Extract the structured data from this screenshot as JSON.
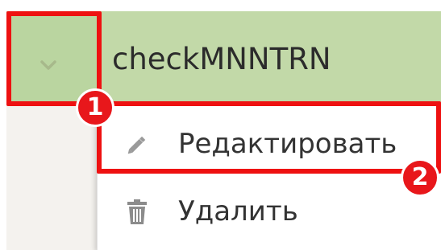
{
  "row": {
    "title": "checkMNNTRN",
    "toggle_icon": "chevron-down-icon"
  },
  "menu": {
    "items": [
      {
        "label": "Редактировать",
        "icon": "pencil-icon"
      },
      {
        "label": "Удалить",
        "icon": "trash-icon"
      }
    ]
  },
  "annotations": {
    "markers": [
      {
        "label": "1",
        "color": "#e8171b"
      },
      {
        "label": "2",
        "color": "#e8171b"
      }
    ]
  },
  "colors": {
    "row_background": "#c2d9a8",
    "highlight": "#ee1111",
    "chevron": "#a7b98b",
    "icon": "#8c8c8c"
  }
}
